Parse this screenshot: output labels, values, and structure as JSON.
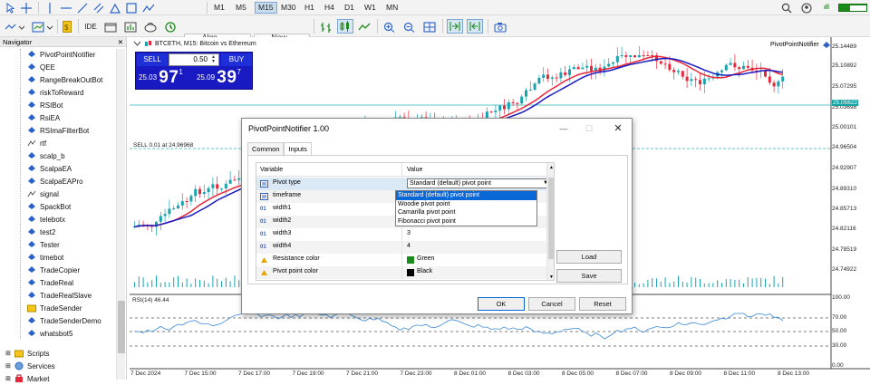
{
  "toolbar": {
    "timeframes": [
      "M1",
      "M5",
      "M15",
      "M30",
      "H1",
      "H4",
      "D1",
      "W1",
      "MN"
    ],
    "selected_timeframe": "M15",
    "ide_label": "IDE",
    "algo_trading_label": "Algo Trading",
    "new_order_label": "New Order",
    "icons": [
      "cursor-icon",
      "crosshair-icon",
      "vertical-line-icon",
      "horizontal-line-icon",
      "trendline-icon",
      "channel-icon",
      "fibonacci-icon",
      "text-icon",
      "shapes-icon",
      "new-chart-icon",
      "templates-icon",
      "profiles-icon",
      "indicators-icon",
      "one-click-icon",
      "zoom-in-icon",
      "zoom-out-icon",
      "tile-icon",
      "scroll-icon",
      "autoscroll-icon",
      "screenshot-icon",
      "search-icon",
      "user-icon",
      "signal-icon"
    ],
    "signal_label": "ıll"
  },
  "navigator": {
    "title": "Navigator",
    "items": [
      {
        "label": "PivotPointNotifier",
        "type": "ea"
      },
      {
        "label": "QEE",
        "type": "ea"
      },
      {
        "label": "RangeBreakOutBot",
        "type": "ea"
      },
      {
        "label": "riskToReward",
        "type": "ea"
      },
      {
        "label": "RSIBot",
        "type": "ea"
      },
      {
        "label": "RsiEA",
        "type": "ea"
      },
      {
        "label": "RSImaFilterBot",
        "type": "ea"
      },
      {
        "label": "rtf",
        "type": "ind"
      },
      {
        "label": "scalp_b",
        "type": "ea"
      },
      {
        "label": "ScalpaEA",
        "type": "ea"
      },
      {
        "label": "ScalpaEAPro",
        "type": "ea"
      },
      {
        "label": "signal",
        "type": "ind"
      },
      {
        "label": "SpackBot",
        "type": "ea"
      },
      {
        "label": "telebotx",
        "type": "ea"
      },
      {
        "label": "test2",
        "type": "ea"
      },
      {
        "label": "Tester",
        "type": "ea"
      },
      {
        "label": "timebot",
        "type": "ea"
      },
      {
        "label": "TradeCopier",
        "type": "ea"
      },
      {
        "label": "TradeReal",
        "type": "ea"
      },
      {
        "label": "TradeRealSlave",
        "type": "ea"
      },
      {
        "label": "TradeSender",
        "type": "folder"
      },
      {
        "label": "TradeSenderDemo",
        "type": "ea"
      },
      {
        "label": "whatsbot5",
        "type": "ea"
      }
    ],
    "sections": [
      "Scripts",
      "Services",
      "Market"
    ]
  },
  "chart": {
    "symbol_title": "BTCETH, M15: Bitcoin vs Ethereum",
    "ea_name": "PivotPointNotifier",
    "sell_label": "SELL",
    "buy_label": "BUY",
    "lot": "0.50",
    "sell_price_small": "25.03",
    "sell_price_big": "97",
    "sell_price_sup": "1",
    "buy_price_small": "25.09",
    "buy_price_big": "39",
    "buy_price_sup": "7",
    "sell_line_label": "SELL 0.01 at 24.96968",
    "price_axis": [
      "25.14489",
      "25.10892",
      "25.07295",
      "25.03698",
      "25.00101",
      "24.96504",
      "24.92907",
      "24.89310",
      "24.85713",
      "24.82116",
      "24.78519",
      "24.74922"
    ],
    "current_price": "25.05622",
    "rsi_label": "RSI(14) 46.44",
    "rsi_axis": [
      "100.00",
      "70.00",
      "50.00",
      "30.00",
      "0.00"
    ],
    "time_axis": [
      "7 Dec 2024",
      "7 Dec 15:00",
      "7 Dec 17:00",
      "7 Dec 19:00",
      "7 Dec 21:00",
      "7 Dec 23:00",
      "8 Dec 01:00",
      "8 Dec 03:00",
      "8 Dec 05:00",
      "8 Dec 07:00",
      "8 Dec 09:00",
      "8 Dec 11:00",
      "8 Dec 13:00"
    ],
    "colors": {
      "bull": "#1aa2b0",
      "bear": "#e8273a",
      "ma_fast": "#e8273a",
      "ma_slow": "#1a1ac2",
      "rsi": "#3b8ad6"
    }
  },
  "dialog": {
    "title": "PivotPointNotifier 1.00",
    "tabs": [
      "Common",
      "Inputs"
    ],
    "active_tab": "Inputs",
    "col_variable": "Variable",
    "col_value": "Value",
    "rows": [
      {
        "name": "Pivot type",
        "value": "Standard (default) pivot point",
        "icon": "enum"
      },
      {
        "name": "timeframe",
        "value": "",
        "icon": "enum"
      },
      {
        "name": "width1",
        "value": "",
        "icon": "int"
      },
      {
        "name": "width2",
        "value": "",
        "icon": "int"
      },
      {
        "name": "width3",
        "value": "3",
        "icon": "int"
      },
      {
        "name": "width4",
        "value": "4",
        "icon": "int"
      },
      {
        "name": "Resistance color",
        "value": "Green",
        "icon": "color",
        "swatch": "#1a8a1a"
      },
      {
        "name": "Pivot point color",
        "value": "Black",
        "icon": "color",
        "swatch": "#000000"
      }
    ],
    "dropdown_options": [
      "Standard (default) pivot point",
      "Woodie pivot point",
      "Camarilla pivot point",
      "Fibonacci pivot point"
    ],
    "load_label": "Load",
    "save_label": "Save",
    "ok_label": "OK",
    "cancel_label": "Cancel",
    "reset_label": "Reset"
  }
}
